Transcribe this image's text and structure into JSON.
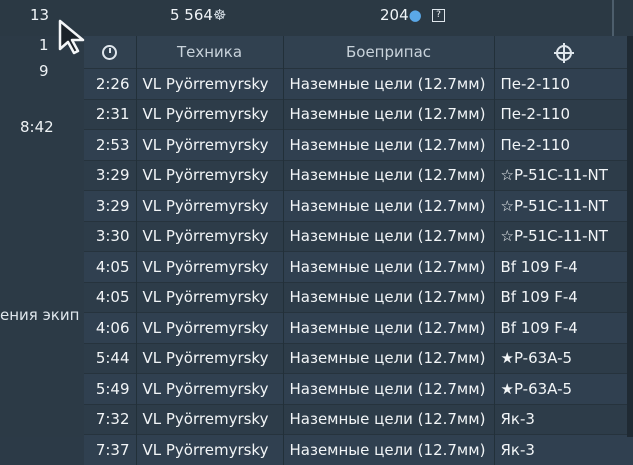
{
  "top": {
    "left_count": "13",
    "lions": "5 564",
    "lion_icon": "lion-icon",
    "eagles": "204",
    "eagle_icon": "eagle-drop-icon",
    "help_icon_text": "?"
  },
  "left": {
    "values": [
      "1",
      "9",
      "8:42"
    ],
    "caption": "ения экип"
  },
  "table": {
    "headers": {
      "time_icon": "clock-icon",
      "vehicle": "Техника",
      "ammo": "Боеприпас",
      "target_icon": "crosshair-icon"
    },
    "rows": [
      {
        "time": "2:26",
        "vehicle": "VL Pyörremyrsky",
        "ammo": "Наземные цели (12.7мм)",
        "target": "Пе-2-110"
      },
      {
        "time": "2:31",
        "vehicle": "VL Pyörremyrsky",
        "ammo": "Наземные цели (12.7мм)",
        "target": "Пе-2-110"
      },
      {
        "time": "2:53",
        "vehicle": "VL Pyörremyrsky",
        "ammo": "Наземные цели (12.7мм)",
        "target": "Пе-2-110"
      },
      {
        "time": "3:29",
        "vehicle": "VL Pyörremyrsky",
        "ammo": "Наземные цели (12.7мм)",
        "target": "☆P-51C-11-NT"
      },
      {
        "time": "3:29",
        "vehicle": "VL Pyörremyrsky",
        "ammo": "Наземные цели (12.7мм)",
        "target": "☆P-51C-11-NT"
      },
      {
        "time": "3:30",
        "vehicle": "VL Pyörremyrsky",
        "ammo": "Наземные цели (12.7мм)",
        "target": "☆P-51C-11-NT"
      },
      {
        "time": "4:05",
        "vehicle": "VL Pyörremyrsky",
        "ammo": "Наземные цели (12.7мм)",
        "target": "Bf 109 F-4"
      },
      {
        "time": "4:05",
        "vehicle": "VL Pyörremyrsky",
        "ammo": "Наземные цели (12.7мм)",
        "target": "Bf 109 F-4"
      },
      {
        "time": "4:06",
        "vehicle": "VL Pyörremyrsky",
        "ammo": "Наземные цели (12.7мм)",
        "target": "Bf 109 F-4"
      },
      {
        "time": "5:44",
        "vehicle": "VL Pyörremyrsky",
        "ammo": "Наземные цели (12.7мм)",
        "target": "★P-63A-5"
      },
      {
        "time": "5:49",
        "vehicle": "VL Pyörremyrsky",
        "ammo": "Наземные цели (12.7мм)",
        "target": "★P-63A-5"
      },
      {
        "time": "7:32",
        "vehicle": "VL Pyörremyrsky",
        "ammo": "Наземные цели (12.7мм)",
        "target": "Як-3"
      },
      {
        "time": "7:37",
        "vehicle": "VL Pyörremyrsky",
        "ammo": "Наземные цели (12.7мм)",
        "target": "Як-3"
      }
    ]
  }
}
